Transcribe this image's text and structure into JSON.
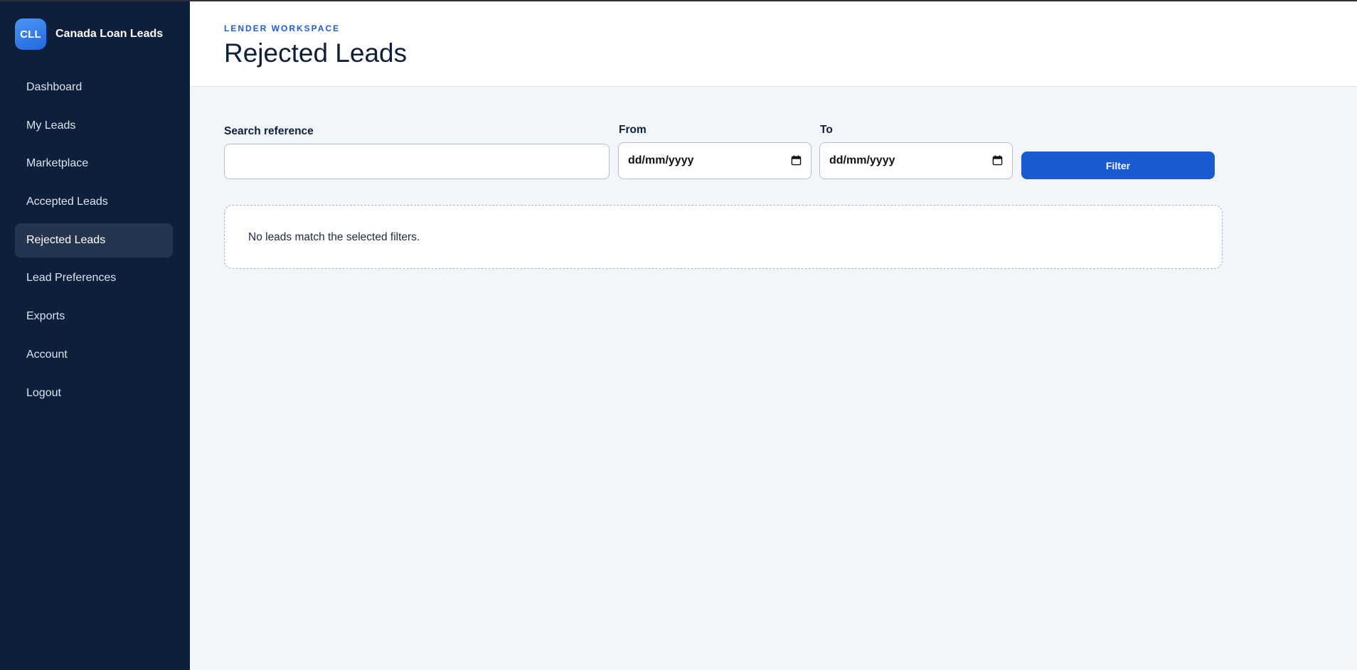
{
  "brand": {
    "logo_text": "CLL",
    "name": "Canada Loan Leads"
  },
  "sidebar": {
    "items": [
      {
        "label": "Dashboard",
        "active": false
      },
      {
        "label": "My Leads",
        "active": false
      },
      {
        "label": "Marketplace",
        "active": false
      },
      {
        "label": "Accepted Leads",
        "active": false
      },
      {
        "label": "Rejected Leads",
        "active": true
      },
      {
        "label": "Lead Preferences",
        "active": false
      },
      {
        "label": "Exports",
        "active": false
      },
      {
        "label": "Account",
        "active": false
      },
      {
        "label": "Logout",
        "active": false
      }
    ]
  },
  "header": {
    "eyebrow": "LENDER WORKSPACE",
    "title": "Rejected Leads"
  },
  "filters": {
    "search_label": "Search reference",
    "search_value": "",
    "from_label": "From",
    "from_value": "dd/mm/yyyy",
    "to_label": "To",
    "to_value": "dd/mm/yyyy",
    "submit_label": "Filter"
  },
  "results": {
    "empty_message": "No leads match the selected filters."
  },
  "colors": {
    "sidebar_bg": "#0d1f3b",
    "sidebar_active_bg": "#26354f",
    "accent": "#1a5ad3",
    "page_bg": "#f2f5fa",
    "title_text": "#0f1f3a"
  },
  "icons": {
    "date_picker": "calendar-icon"
  }
}
